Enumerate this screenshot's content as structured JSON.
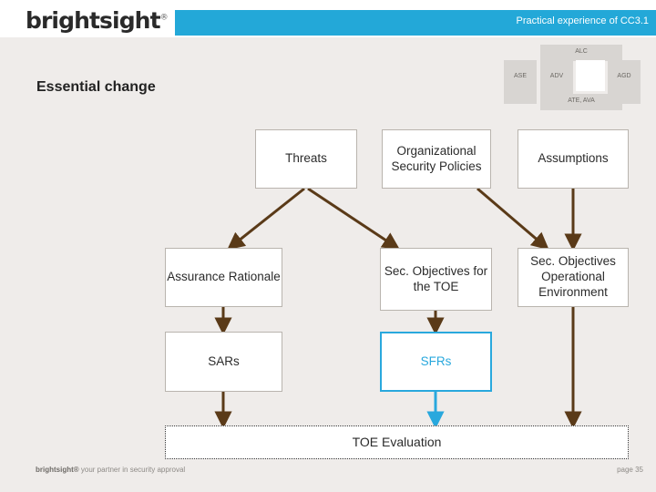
{
  "header": {
    "logo_text": "brightsight",
    "logo_sup": "®",
    "title": "Practical experience of CC3.1"
  },
  "slide": {
    "title": "Essential change"
  },
  "class_tags": [
    {
      "name": "tag-alc",
      "label": "ALC"
    },
    {
      "name": "tag-ase",
      "label": "ASE"
    },
    {
      "name": "tag-adv",
      "label": "ADV"
    },
    {
      "name": "tag-agd",
      "label": "AGD"
    },
    {
      "name": "tag-ate",
      "label": "ATE, AVA"
    }
  ],
  "diagram": {
    "boxes": [
      {
        "name": "threats-box",
        "label": "Threats"
      },
      {
        "name": "osp-box",
        "label": "Organizational Security Policies"
      },
      {
        "name": "assumptions-box",
        "label": "Assumptions"
      },
      {
        "name": "assurance-rationale-box",
        "label": "Assurance Rationale"
      },
      {
        "name": "sec-objectives-toe-box",
        "label": "Sec. Objectives for the TOE"
      },
      {
        "name": "sec-objectives-env-box",
        "label": "Sec. Objectives Operational Environment"
      },
      {
        "name": "sars-box",
        "label": "SARs"
      },
      {
        "name": "sfrs-box",
        "label": "SFRs"
      },
      {
        "name": "toe-evaluation-box",
        "label": "TOE Evaluation"
      }
    ]
  },
  "footer": {
    "tagline_brand": "brightsight®",
    "tagline_rest": " your partner in security approval",
    "page": "page 35"
  },
  "colors": {
    "brand_blue": "#23a8d8",
    "arrow_brown": "#5a3a18",
    "arrow_blue": "#29a8dd",
    "background": "#efecea"
  }
}
